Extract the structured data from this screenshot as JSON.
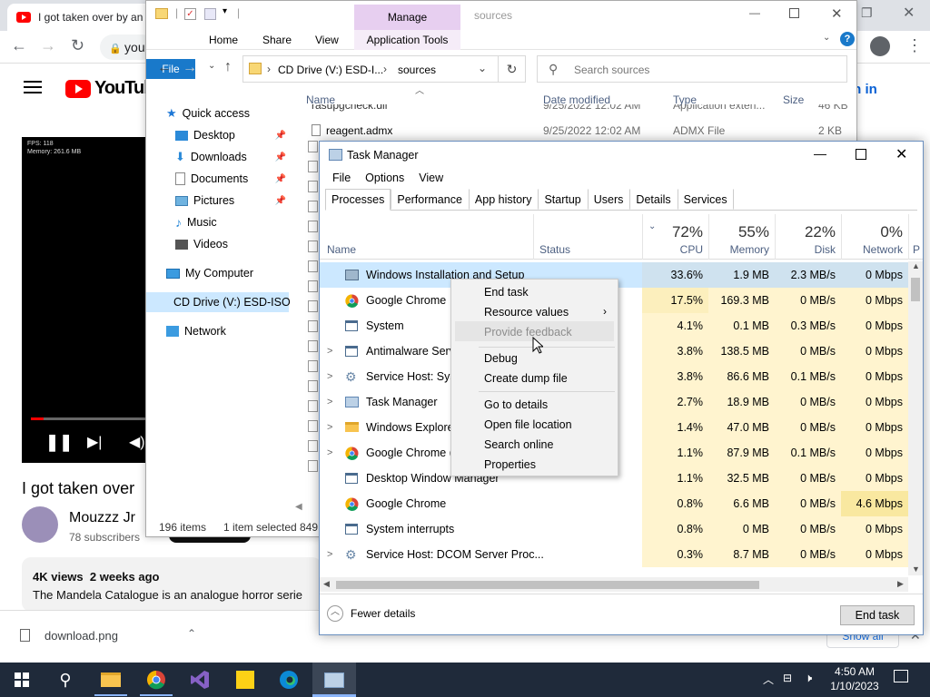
{
  "chrome": {
    "tab_title": "I got taken over by an",
    "address_partial": "you",
    "sign_in": "gn in",
    "video_overlay_fps": "FPS: 118",
    "video_overlay_mem": "Memory: 261.6 MB",
    "video_title": "I got taken over",
    "channel_name": "Mouzzz Jr",
    "subscribers": "78 subscribers",
    "views": "4K views",
    "age": "2 weeks ago",
    "description": "The Mandela Catalogue is an analogue horror serie",
    "download_file": "download.png",
    "show_all": "Show all",
    "brand": "YouTube"
  },
  "explorer": {
    "title": "sources",
    "manage_tab": "Manage",
    "ribbon_tabs": [
      "File",
      "Home",
      "Share",
      "View",
      "Application Tools"
    ],
    "address": {
      "drive": "CD Drive (V:) ESD-I...",
      "folder": "sources"
    },
    "search_placeholder": "Search sources",
    "columns": [
      "Name",
      "Date modified",
      "Type",
      "Size"
    ],
    "files": [
      {
        "name": "rasupgcheck.dll",
        "date": "9/25/2022 12:02 AM",
        "type": "Application exten...",
        "size": "46 KB"
      },
      {
        "name": "reagent.admx",
        "date": "9/25/2022 12:02 AM",
        "type": "ADMX File",
        "size": "2 KB"
      }
    ],
    "nav": {
      "quick_access": "Quick access",
      "items": [
        "Desktop",
        "Downloads",
        "Documents",
        "Pictures",
        "Music",
        "Videos"
      ],
      "my_computer": "My Computer",
      "cd_drive": "CD Drive (V:) ESD-ISO",
      "network": "Network"
    },
    "status": {
      "count": "196 items",
      "selected": "1 item selected",
      "size": "849"
    }
  },
  "taskmgr": {
    "title": "Task Manager",
    "menu": [
      "File",
      "Options",
      "View"
    ],
    "tabs": [
      "Processes",
      "Performance",
      "App history",
      "Startup",
      "Users",
      "Details",
      "Services"
    ],
    "header": {
      "name": "Name",
      "status": "Status",
      "cpu_pct": "72%",
      "cpu": "CPU",
      "mem_pct": "55%",
      "mem": "Memory",
      "disk_pct": "22%",
      "disk": "Disk",
      "net_pct": "0%",
      "net": "Network",
      "extra": "P"
    },
    "rows": [
      {
        "name": "Windows Installation and Setup",
        "cpu": "33.6%",
        "mem": "1.9 MB",
        "disk": "2.3 MB/s",
        "net": "0 Mbps",
        "expand": "",
        "icon": "setup-icon"
      },
      {
        "name": "Google Chrome",
        "cpu": "17.5%",
        "mem": "169.3 MB",
        "disk": "0 MB/s",
        "net": "0 Mbps",
        "expand": "",
        "icon": "chrome-icon"
      },
      {
        "name": "System",
        "cpu": "4.1%",
        "mem": "0.1 MB",
        "disk": "0.3 MB/s",
        "net": "0 Mbps",
        "expand": "",
        "icon": "window-icon"
      },
      {
        "name": "Antimalware Servi",
        "cpu": "3.8%",
        "mem": "138.5 MB",
        "disk": "0 MB/s",
        "net": "0 Mbps",
        "expand": ">",
        "icon": "window-icon"
      },
      {
        "name": "Service Host: SysM",
        "cpu": "3.8%",
        "mem": "86.6 MB",
        "disk": "0.1 MB/s",
        "net": "0 Mbps",
        "expand": ">",
        "icon": "gear-icon"
      },
      {
        "name": "Task Manager",
        "cpu": "2.7%",
        "mem": "18.9 MB",
        "disk": "0 MB/s",
        "net": "0 Mbps",
        "expand": ">",
        "icon": "taskmgr-icon"
      },
      {
        "name": "Windows Explorer",
        "cpu": "1.4%",
        "mem": "47.0 MB",
        "disk": "0 MB/s",
        "net": "0 Mbps",
        "expand": ">",
        "icon": "folder-icon"
      },
      {
        "name": "Google Chrome (4",
        "cpu": "1.1%",
        "mem": "87.9 MB",
        "disk": "0.1 MB/s",
        "net": "0 Mbps",
        "expand": ">",
        "icon": "chrome-icon"
      },
      {
        "name": "Desktop Window Manager",
        "cpu": "1.1%",
        "mem": "32.5 MB",
        "disk": "0 MB/s",
        "net": "0 Mbps",
        "expand": "",
        "icon": "window-icon"
      },
      {
        "name": "Google Chrome",
        "cpu": "0.8%",
        "mem": "6.6 MB",
        "disk": "0 MB/s",
        "net": "4.6 Mbps",
        "expand": "",
        "icon": "chrome-icon"
      },
      {
        "name": "System interrupts",
        "cpu": "0.8%",
        "mem": "0 MB",
        "disk": "0 MB/s",
        "net": "0 Mbps",
        "expand": "",
        "icon": "window-icon"
      },
      {
        "name": "Service Host: DCOM Server Proc...",
        "cpu": "0.3%",
        "mem": "8.7 MB",
        "disk": "0 MB/s",
        "net": "0 Mbps",
        "expand": ">",
        "icon": "gear-icon"
      }
    ],
    "fewer_details": "Fewer details",
    "end_task": "End task"
  },
  "context_menu": {
    "end_task": "End task",
    "resource_values": "Resource values",
    "provide_feedback": "Provide feedback",
    "debug": "Debug",
    "create_dump": "Create dump file",
    "go_to_details": "Go to details",
    "open_file_location": "Open file location",
    "search_online": "Search online",
    "properties": "Properties"
  },
  "taskbar": {
    "time": "4:50 AM",
    "date": "1/10/2023"
  }
}
